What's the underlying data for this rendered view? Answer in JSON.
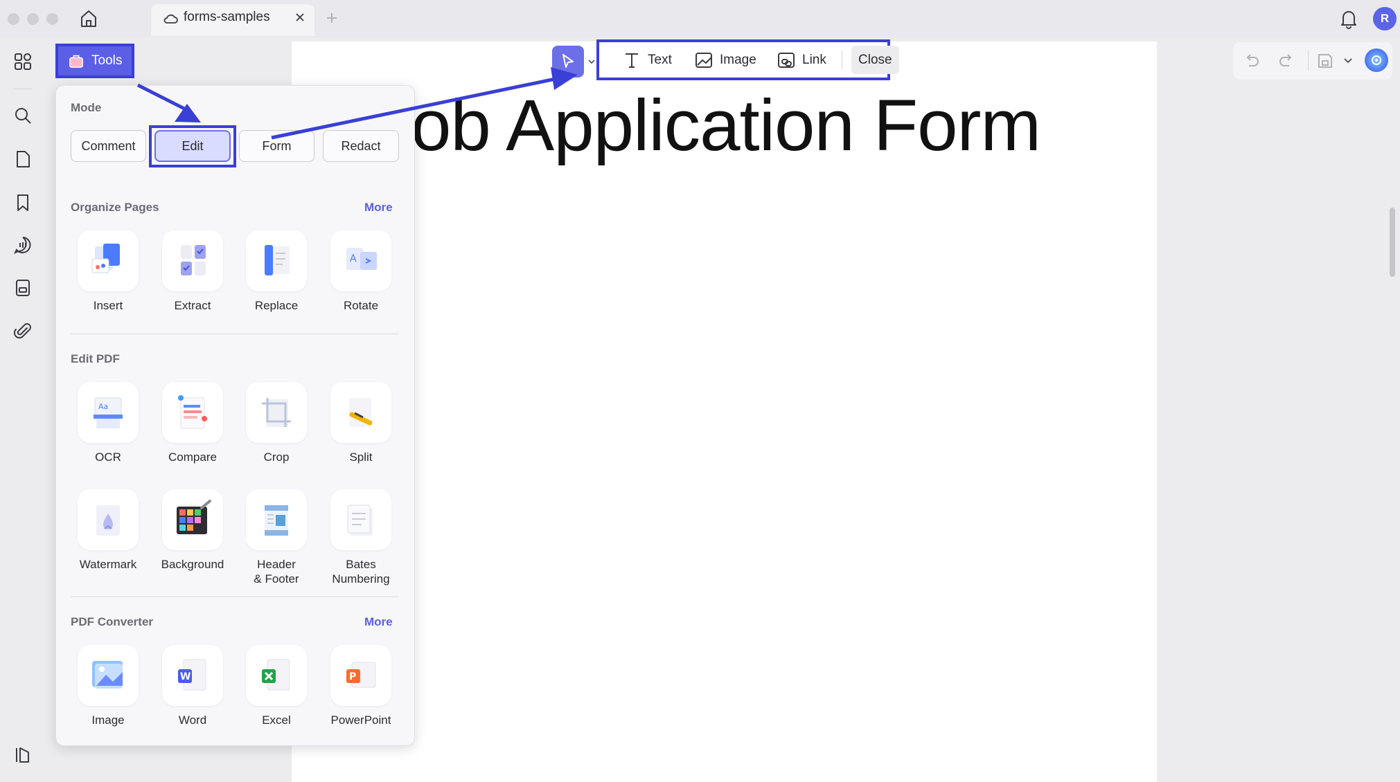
{
  "tab": {
    "title": "forms-samples"
  },
  "user": {
    "avatar_initial": "R"
  },
  "tools_button": {
    "label": "Tools"
  },
  "edit_toolbar": {
    "text": "Text",
    "image": "Image",
    "link": "Link",
    "close": "Close"
  },
  "document": {
    "title_visible": "ob Application Form"
  },
  "panel": {
    "mode": {
      "title": "Mode",
      "buttons": [
        "Comment",
        "Edit",
        "Form",
        "Redact"
      ],
      "selected": "Edit"
    },
    "organize_pages": {
      "title": "Organize Pages",
      "more": "More",
      "tools": [
        "Insert",
        "Extract",
        "Replace",
        "Rotate"
      ]
    },
    "edit_pdf": {
      "title": "Edit PDF",
      "tools": [
        "OCR",
        "Compare",
        "Crop",
        "Split",
        "Watermark",
        "Background",
        "Header\n& Footer",
        "Bates\nNumbering"
      ]
    },
    "pdf_converter": {
      "title": "PDF Converter",
      "more": "More",
      "tools": [
        "Image",
        "Word",
        "Excel",
        "PowerPoint"
      ]
    }
  },
  "colors": {
    "accent": "#5b5fe6",
    "annotation": "#3a3fd6",
    "panel_bg": "#f7f7fa"
  }
}
